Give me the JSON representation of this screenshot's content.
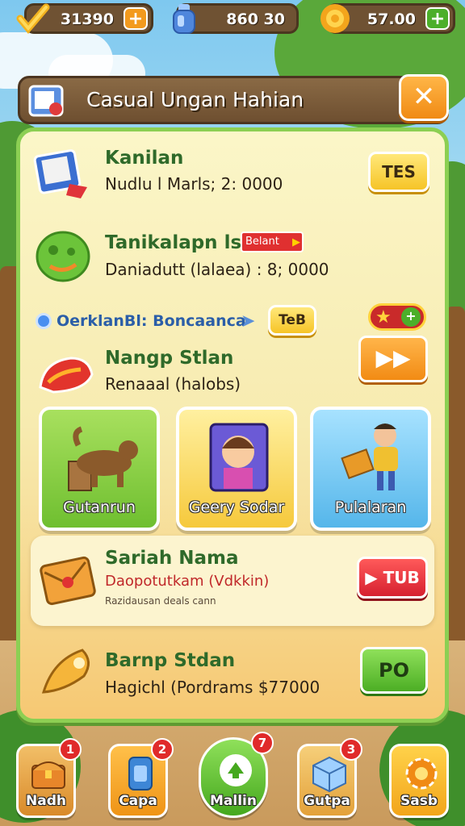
{
  "resources": [
    {
      "icon": "checkmark-icon",
      "value": "31390",
      "plus": "+",
      "accent": "#f39a1d"
    },
    {
      "icon": "potion-bottle-icon",
      "value": "860  30",
      "plus": "",
      "accent": "#5a8fe0"
    },
    {
      "icon": "sun-gear-icon",
      "value": "57.00",
      "plus": "+",
      "accent": "#4caf2a"
    }
  ],
  "header": {
    "title": "Casual Ungan Hahian",
    "close": "✕"
  },
  "rows": [
    {
      "icon": "book-icon",
      "title": "Kanilan",
      "subtitle": "Nudlu l Marls; 2: 0000",
      "button": "TES"
    },
    {
      "icon": "green-blob-icon",
      "title": "Tanikalapn lsn",
      "tag": "Belant",
      "subtitle": "Daniadutt (lalaea) : 8; 0000"
    },
    {
      "icon": "bell-icon",
      "title": "Nangp Stlan",
      "subtitle": "Renaaal (halobs)",
      "button": "▶▶"
    }
  ],
  "info_bar": {
    "left": "OerklanBl: Boncaanca",
    "badge": "TeB"
  },
  "cards": [
    {
      "icon": "dog-icon",
      "label": "Gutanrun",
      "color": "#7fcc3f"
    },
    {
      "icon": "portrait-icon",
      "label": "Geery Sodar",
      "color": "#f6d04d"
    },
    {
      "icon": "worker-icon",
      "label": "Pulalaran",
      "color": "#5cbde8"
    }
  ],
  "feature": {
    "icon": "envelope-icon",
    "title": "Sariah Nama",
    "subtitle": "Daopotutkam (Vdkkin)",
    "note": "Razidausan deals cann",
    "button": "▶ TUB"
  },
  "bottom_row": {
    "icon": "rocket-icon",
    "title": "Barnp Stdan",
    "subtitle": "Hagichl (Pordrams $77000",
    "button": "PO"
  },
  "nav": [
    {
      "icon": "chest-icon",
      "label": "Nadh",
      "badge": "1",
      "color": "#e6a244"
    },
    {
      "icon": "card-icon",
      "label": "Capa",
      "badge": "2",
      "color": "#f3a526"
    },
    {
      "icon": "home-icon",
      "label": "Mallin",
      "badge": "7",
      "color": "#5cc23a"
    },
    {
      "icon": "cube-icon",
      "label": "Gutpa",
      "badge": "3",
      "color": "#f0b84e"
    },
    {
      "icon": "settings-icon",
      "label": "Sasb",
      "badge": "",
      "color": "#f5b42a"
    }
  ]
}
